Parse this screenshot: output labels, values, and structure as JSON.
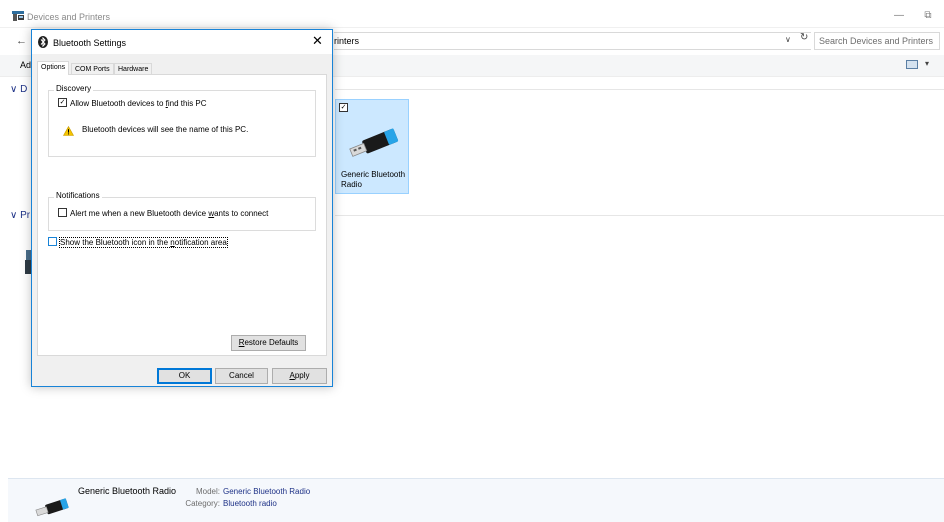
{
  "explorer": {
    "title": "Devices and Printers",
    "address_text": "rinters",
    "search_placeholder": "Search Devices and Printers",
    "command_left": "Ad",
    "group_devices": "∨ D",
    "group_printers": "∨ Pr",
    "device_tile_label": "Generic Bluetooth Radio",
    "device_tile_checked": true,
    "details": {
      "name": "Generic Bluetooth Radio",
      "model_label": "Model:",
      "model_value": "Generic Bluetooth Radio",
      "category_label": "Category:",
      "category_value": "Bluetooth radio"
    }
  },
  "dialog": {
    "title": "Bluetooth Settings",
    "close_glyph": "✕",
    "tabs": [
      "Options",
      "COM Ports",
      "Hardware"
    ],
    "active_tab": "Options",
    "discovery": {
      "legend": "Discovery",
      "allow_label_pre": "Allow Bluetooth devices to ",
      "allow_label_key": "f",
      "allow_label_post": "ind this PC",
      "allow_checked": true,
      "warning": "Bluetooth devices will see the name of this PC."
    },
    "notifications": {
      "legend": "Notifications",
      "alert_label_pre": "Alert me when a new Bluetooth device ",
      "alert_label_key": "w",
      "alert_label_post": "ants to connect",
      "alert_checked": false
    },
    "show_icon": {
      "label_pre": "Show the Bluetooth icon in the ",
      "label_key": "n",
      "label_post": "otification area",
      "checked": false
    },
    "restore_defaults": {
      "key": "R",
      "rest": "estore Defaults"
    },
    "ok": "OK",
    "cancel": "Cancel",
    "apply": {
      "key": "A",
      "rest": "pply"
    }
  },
  "colors": {
    "accent": "#0078d7",
    "selection": "#cce8ff",
    "link_blue": "#1e3287"
  },
  "icons": {
    "app": "devices-printers-icon",
    "bluetooth": "bluetooth-icon",
    "warning": "warning-icon",
    "usb_dongle": "usb-bluetooth-dongle-icon"
  }
}
